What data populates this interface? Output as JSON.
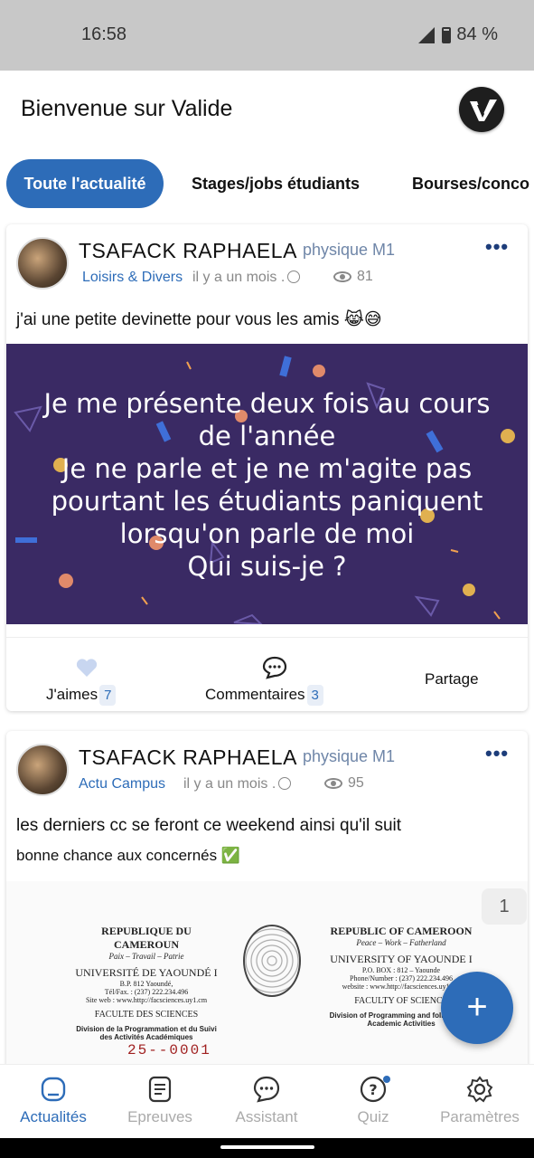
{
  "status": {
    "time": "16:58",
    "battery": "84 %"
  },
  "header": {
    "title": "Bienvenue sur Valide",
    "logo_icon": "valide-logo-icon"
  },
  "tabs": [
    {
      "label": "Toute l'actualité",
      "active": true
    },
    {
      "label": "Stages/jobs étudiants",
      "active": false
    },
    {
      "label": "Bourses/conco",
      "active": false
    }
  ],
  "posts": [
    {
      "author": "TSAFACK  RAPHAELA",
      "role": "physique M1",
      "category": "Loisirs & Divers",
      "time": "il y a un mois .",
      "views": "81",
      "text": "j'ai une petite devinette pour vous les amis 😹😅",
      "image_text": [
        "Je me présente deux fois au cours",
        "de l'année",
        "Je ne parle et je ne m'agite pas",
        "pourtant les étudiants paniquent",
        "lorsqu'on parle de moi",
        "Qui suis-je ?"
      ],
      "actions": {
        "like_label": "J'aimes",
        "like_count": "7",
        "comment_label": "Commentaires",
        "comment_count": "3",
        "share_label": "Partage"
      }
    },
    {
      "author": "TSAFACK  RAPHAELA",
      "role": "physique M1",
      "category": "Actu Campus",
      "time": "il y a un mois .",
      "views": "95",
      "text": "les derniers cc se feront ce weekend ainsi qu'il suit",
      "text2": "bonne chance aux concernés ✅",
      "page_badge": "1",
      "document": {
        "left": [
          "REPUBLIQUE DU CAMEROUN",
          "Paix – Travail – Patrie",
          "UNIVERSITÉ DE YAOUNDÉ I",
          "B.P. 812 Yaoundé,",
          "Tél/Fax. : (237) 222.234.496",
          "Site web : www.http://facsciences.uy1.cm",
          "FACULTE DES SCIENCES",
          "Division de la Programmation et du Suivi",
          "des Activités Académiques"
        ],
        "right": [
          "REPUBLIC OF CAMEROON",
          "Peace – Work – Fatherland",
          "UNIVERSITY OF YAOUNDE I",
          "P.O. BOX : 812 – Yaounde",
          "Phone/Number : (237) 222.234.496",
          "website : www.http://facsciences.uy1.cm",
          "FACULTY OF SCIENCE",
          "Division of Programming and follow up of",
          "Academic Activities"
        ],
        "ref": "25--0001"
      }
    }
  ],
  "fab": {
    "label": "+",
    "icon": "plus-icon"
  },
  "bottom_nav": [
    {
      "label": "Actualités",
      "icon": "news-icon",
      "active": true
    },
    {
      "label": "Epreuves",
      "icon": "document-icon",
      "active": false
    },
    {
      "label": "Assistant",
      "icon": "chat-icon",
      "active": false
    },
    {
      "label": "Quiz",
      "icon": "question-icon",
      "active": false
    },
    {
      "label": "Paramètres",
      "icon": "gear-icon",
      "active": false
    }
  ]
}
